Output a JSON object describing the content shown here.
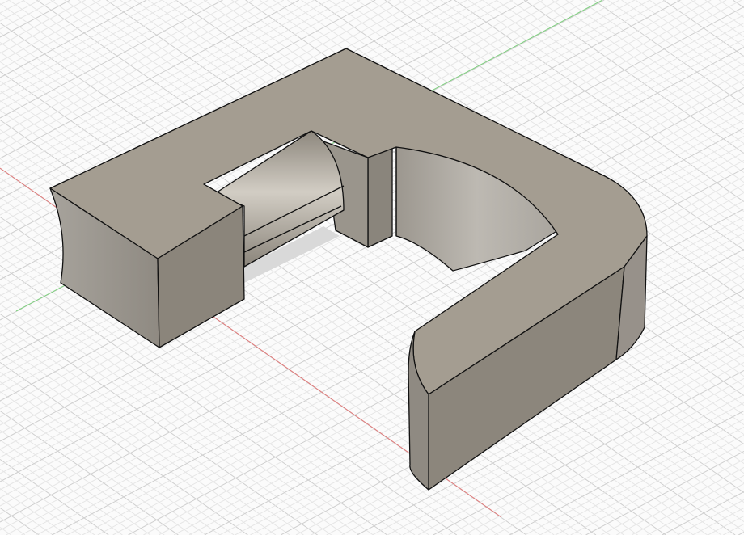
{
  "viewport": {
    "colors": {
      "background": "#fbfbfb",
      "grid_minor": "#e6e6e6",
      "grid_major": "#cfcfcf",
      "x_axis": "#e07a7a",
      "y_axis": "#7fd07f",
      "model_top": "#a49d91",
      "model_side": "#8e887e",
      "model_edge": "#111111"
    }
  }
}
